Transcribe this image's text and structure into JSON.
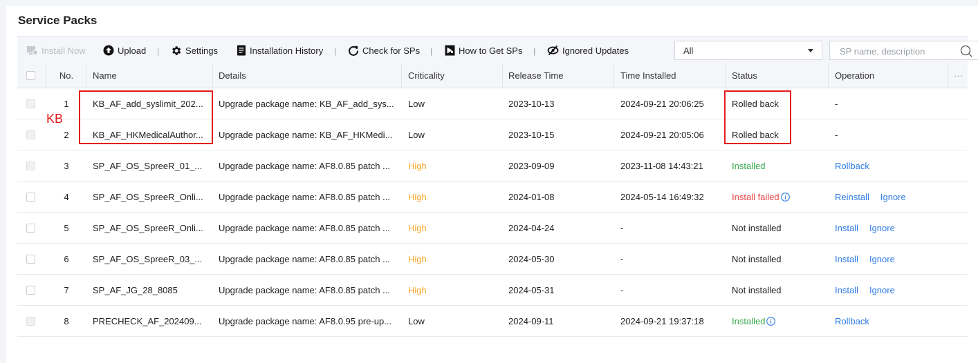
{
  "page": {
    "title": "Service Packs"
  },
  "toolbar": {
    "install_now": "Install Now",
    "upload": "Upload",
    "settings": "Settings",
    "installation_history": "Installation History",
    "check_for_sps": "Check for SPs",
    "how_to_get_sps": "How to Get SPs",
    "ignored_updates": "Ignored Updates",
    "separator": "|",
    "filter_value": "All",
    "search_placeholder": "SP name, description"
  },
  "columns": {
    "no": "No.",
    "name": "Name",
    "details": "Details",
    "criticality": "Criticality",
    "release_time": "Release Time",
    "time_installed": "Time Installed",
    "status": "Status",
    "operation": "Operation",
    "more": "···"
  },
  "rows": [
    {
      "no": "1",
      "name": "KB_AF_add_syslimit_202...",
      "details": "Upgrade package name: KB_AF_add_sys...",
      "criticality": "Low",
      "release": "2023-10-13",
      "installed": "2024-09-21 20:06:25",
      "status": "Rolled back",
      "op": "-"
    },
    {
      "no": "2",
      "name": "KB_AF_HKMedicalAuthor...",
      "details": "Upgrade package name: KB_AF_HKMedi...",
      "criticality": "Low",
      "release": "2023-10-15",
      "installed": "2024-09-21 20:05:06",
      "status": "Rolled back",
      "op": "-"
    },
    {
      "no": "3",
      "name": "SP_AF_OS_SpreeR_01_...",
      "details": "Upgrade package name: AF8.0.85 patch ...",
      "criticality": "High",
      "release": "2023-09-09",
      "installed": "2023-11-08 14:43:21",
      "status": "Installed",
      "op1": "Rollback"
    },
    {
      "no": "4",
      "name": "SP_AF_OS_SpreeR_Onli...",
      "details": "Upgrade package name: AF8.0.85 patch ...",
      "criticality": "High",
      "release": "2024-01-08",
      "installed": "2024-05-14 16:49:32",
      "status": "Install failed",
      "op1": "Reinstall",
      "op2": "Ignore"
    },
    {
      "no": "5",
      "name": "SP_AF_OS_SpreeR_Onli...",
      "details": "Upgrade package name: AF8.0.85 patch ...",
      "criticality": "High",
      "release": "2024-04-24",
      "installed": "-",
      "status": "Not installed",
      "op1": "Install",
      "op2": "Ignore"
    },
    {
      "no": "6",
      "name": "SP_AF_OS_SpreeR_03_...",
      "details": "Upgrade package name: AF8.0.85 patch ...",
      "criticality": "High",
      "release": "2024-05-30",
      "installed": "-",
      "status": "Not installed",
      "op1": "Install",
      "op2": "Ignore"
    },
    {
      "no": "7",
      "name": "SP_AF_JG_28_8085",
      "details": "Upgrade package name: AF8.0.85 patch ...",
      "criticality": "High",
      "release": "2024-05-31",
      "installed": "-",
      "status": "Not installed",
      "op1": "Install",
      "op2": "Ignore"
    },
    {
      "no": "8",
      "name": "PRECHECK_AF_202409...",
      "details": "Upgrade package name: AF8.0.95 pre-up...",
      "criticality": "Low",
      "release": "2024-09-11",
      "installed": "2024-09-21 19:37:18",
      "status": "Installed",
      "op1": "Rollback"
    }
  ],
  "annotation": {
    "label": "KB",
    "color": "#e41b1b"
  },
  "colors": {
    "link": "#2d7be5",
    "high": "#f5a623",
    "installed": "#35a74a",
    "failed": "#e54545"
  }
}
